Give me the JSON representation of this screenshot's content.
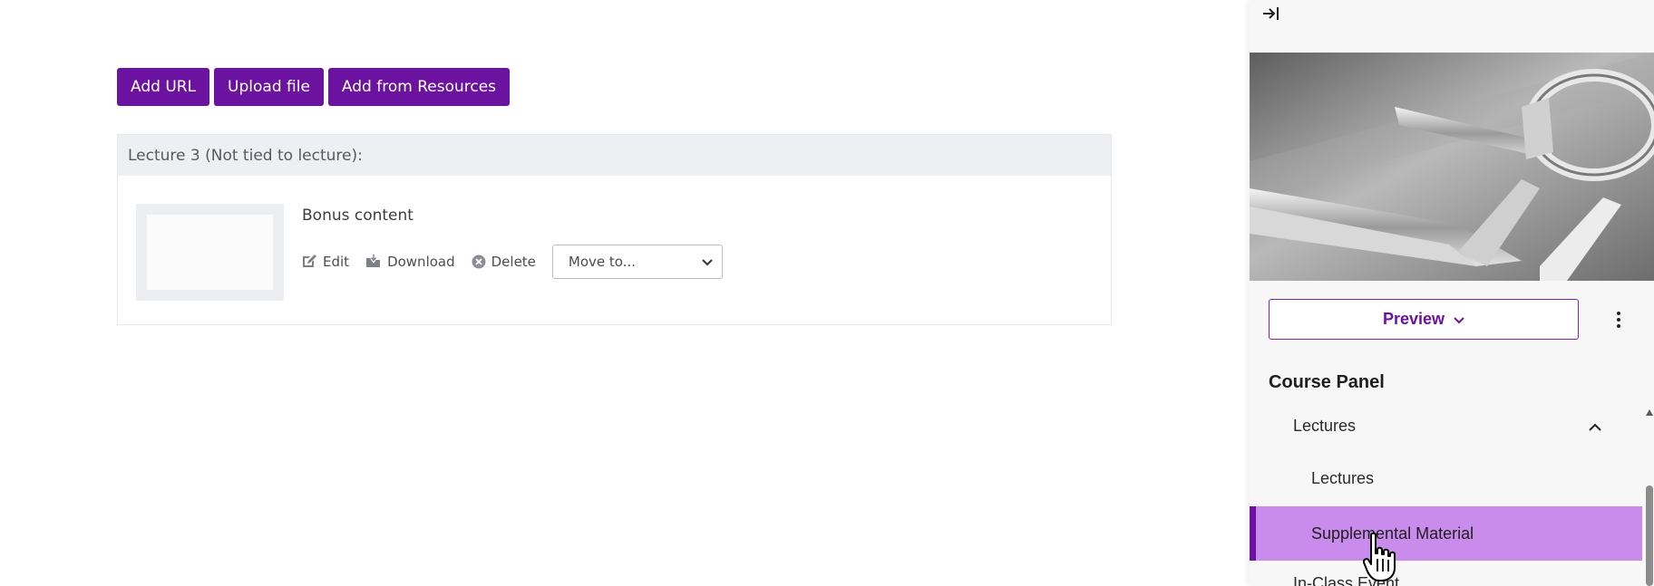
{
  "toolbar": {
    "add_url_label": "Add URL",
    "upload_file_label": "Upload file",
    "add_from_resources_label": "Add from Resources"
  },
  "section": {
    "header": "Lecture 3 (Not tied to lecture):",
    "items": [
      {
        "title": "Bonus content",
        "actions": {
          "edit_label": "Edit",
          "download_label": "Download",
          "delete_label": "Delete"
        },
        "move_select": {
          "selected": "Move to..."
        }
      }
    ]
  },
  "panel": {
    "collapse_icon": "collapse-right-icon",
    "preview_label": "Preview",
    "title": "Course Panel",
    "nav": {
      "group_label": "Lectures",
      "sub_items": [
        "Lectures",
        "Supplemental Material"
      ],
      "active_item": "Supplemental Material",
      "next_item": "In-Class Event"
    }
  },
  "colors": {
    "brand_purple": "#6b12a0",
    "active_nav_bg": "#c98bec",
    "section_header_bg": "#eeeff2"
  }
}
